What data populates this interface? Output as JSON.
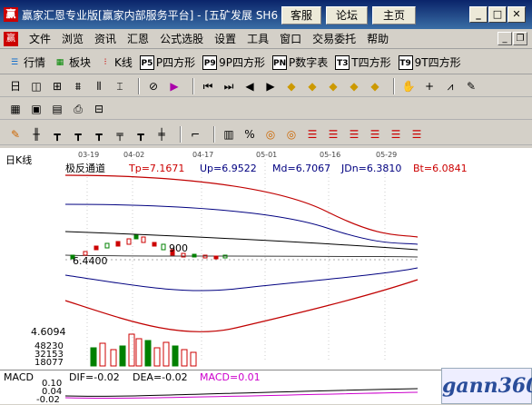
{
  "window": {
    "title": "赢家汇恩专业版[赢家内部服务平台] - [五矿发展 SH6",
    "tab_bbs": "客服",
    "tab_forum": "论坛",
    "tab_home": "主页"
  },
  "menu": [
    "文件",
    "浏览",
    "资讯",
    "汇恩",
    "公式选股",
    "设置",
    "工具",
    "窗口",
    "交易委托",
    "帮助"
  ],
  "viewbar": [
    {
      "icon": "quote-icon",
      "label": "行情"
    },
    {
      "icon": "block-icon",
      "label": "板块"
    },
    {
      "icon": "kline-icon",
      "label": "K线"
    },
    {
      "icon": "p-grid-icon",
      "label": "P四方形",
      "badge": "P5"
    },
    {
      "icon": "9p-grid-icon",
      "label": "9P四方形",
      "badge": "P9"
    },
    {
      "icon": "pnum-icon",
      "label": "P数字表",
      "badge": "PN"
    },
    {
      "icon": "t-grid-icon",
      "label": "T四方形",
      "badge": "T3"
    },
    {
      "icon": "9t-grid-icon",
      "label": "9T四方形",
      "badge": "T9"
    }
  ],
  "chart": {
    "period_label": "日K线",
    "indicator_name": "极反通道",
    "tp": "Tp=7.1671",
    "up": "Up=6.9522",
    "md": "Md=6.7067",
    "dn": "JDn=6.3810",
    "bt": "Bt=6.0841",
    "dates": [
      "03-19",
      "04-02",
      "04-17",
      "05-01",
      "05-16",
      "05-29"
    ],
    "price_low_label": "6.4400",
    "price_mid_label": "900",
    "price_axis_label": "4.6094",
    "volume_labels": [
      "48230",
      "32153",
      "18077"
    ],
    "colors": {
      "upper": "#c00000",
      "lower": "#c00000",
      "mid": "#000080",
      "up_candle": "#008000"
    }
  },
  "macd": {
    "name": "MACD",
    "dif": "DIF=-0.02",
    "dea": "DEA=-0.02",
    "macd": "MACD=0.01",
    "axis": [
      "0.10",
      "0.04",
      "-0.02"
    ]
  },
  "watermark": "gann360"
}
